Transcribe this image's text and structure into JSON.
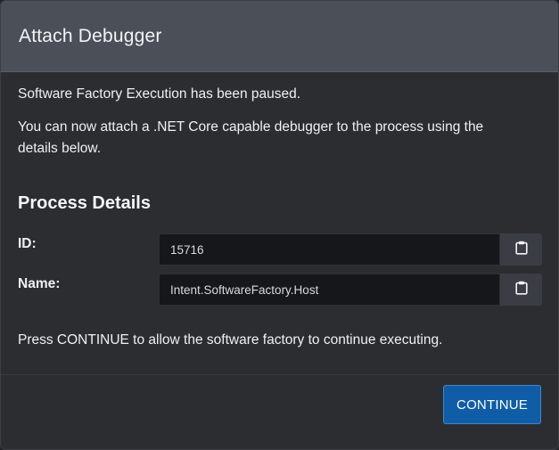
{
  "dialog": {
    "title": "Attach Debugger"
  },
  "body": {
    "paused_text": "Software Factory Execution has been paused.",
    "instructions_text": "You can now attach a .NET Core capable debugger to the process using the details below.",
    "section_title": "Process Details",
    "fields": [
      {
        "label": "ID:",
        "value": "15716",
        "copy_icon": "clipboard-icon"
      },
      {
        "label": "Name:",
        "value": "Intent.SoftwareFactory.Host",
        "copy_icon": "clipboard-icon"
      }
    ],
    "continue_hint": "Press CONTINUE to allow the software factory to continue executing."
  },
  "footer": {
    "continue_label": "CONTINUE"
  },
  "colors": {
    "header_bg": "#4b4f57",
    "body_bg": "#2b2d31",
    "input_bg": "#16171a",
    "copy_button_bg": "#3a3d43",
    "primary_button": "#0f5da7"
  }
}
